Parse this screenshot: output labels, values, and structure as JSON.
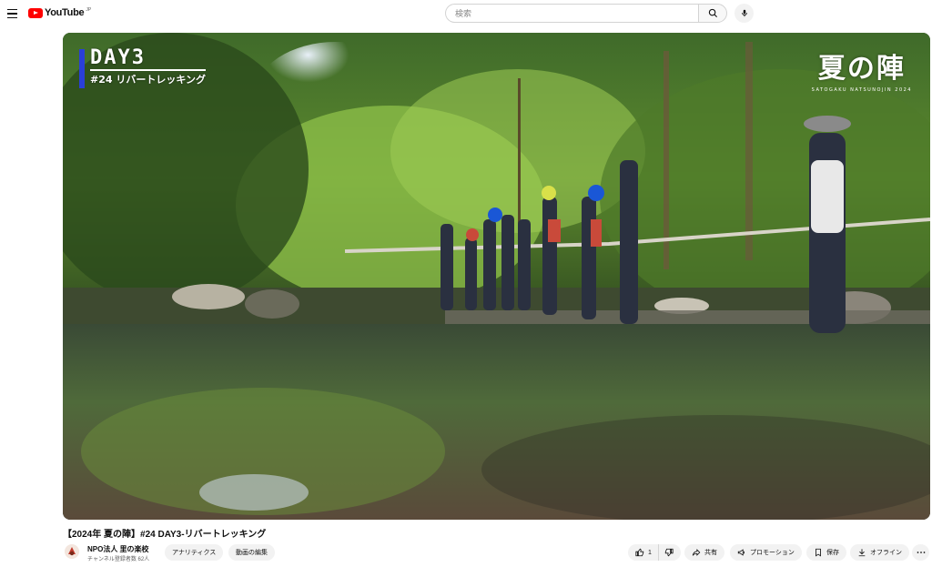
{
  "header": {
    "logo_text": "YouTube",
    "logo_country": "JP",
    "search_placeholder": "検索",
    "icons": [
      "menu-icon",
      "search-icon",
      "mic-icon"
    ]
  },
  "video": {
    "overlay": {
      "day_label": "DAY3",
      "episode_label": "#24 リバートレッキング",
      "brand_title": "夏の陣",
      "brand_subtitle": "SATOGAKU  NATSUNOJIN  2024"
    },
    "title": "【2024年 夏の陣】#24 DAY3-リバートレッキング"
  },
  "channel": {
    "name": "NPO法人 里の楽校",
    "subscribers": "チャンネル登録者数 62人",
    "analytics_label": "アナリティクス",
    "edit_label": "動画の編集"
  },
  "actions": {
    "like_count": "1",
    "share_label": "共有",
    "promote_label": "プロモーション",
    "save_label": "保存",
    "offline_label": "オフライン"
  },
  "colors": {
    "brand_red": "#ff0000",
    "pill_bg": "#f2f2f2",
    "day_accent": "#2a3fd8"
  }
}
